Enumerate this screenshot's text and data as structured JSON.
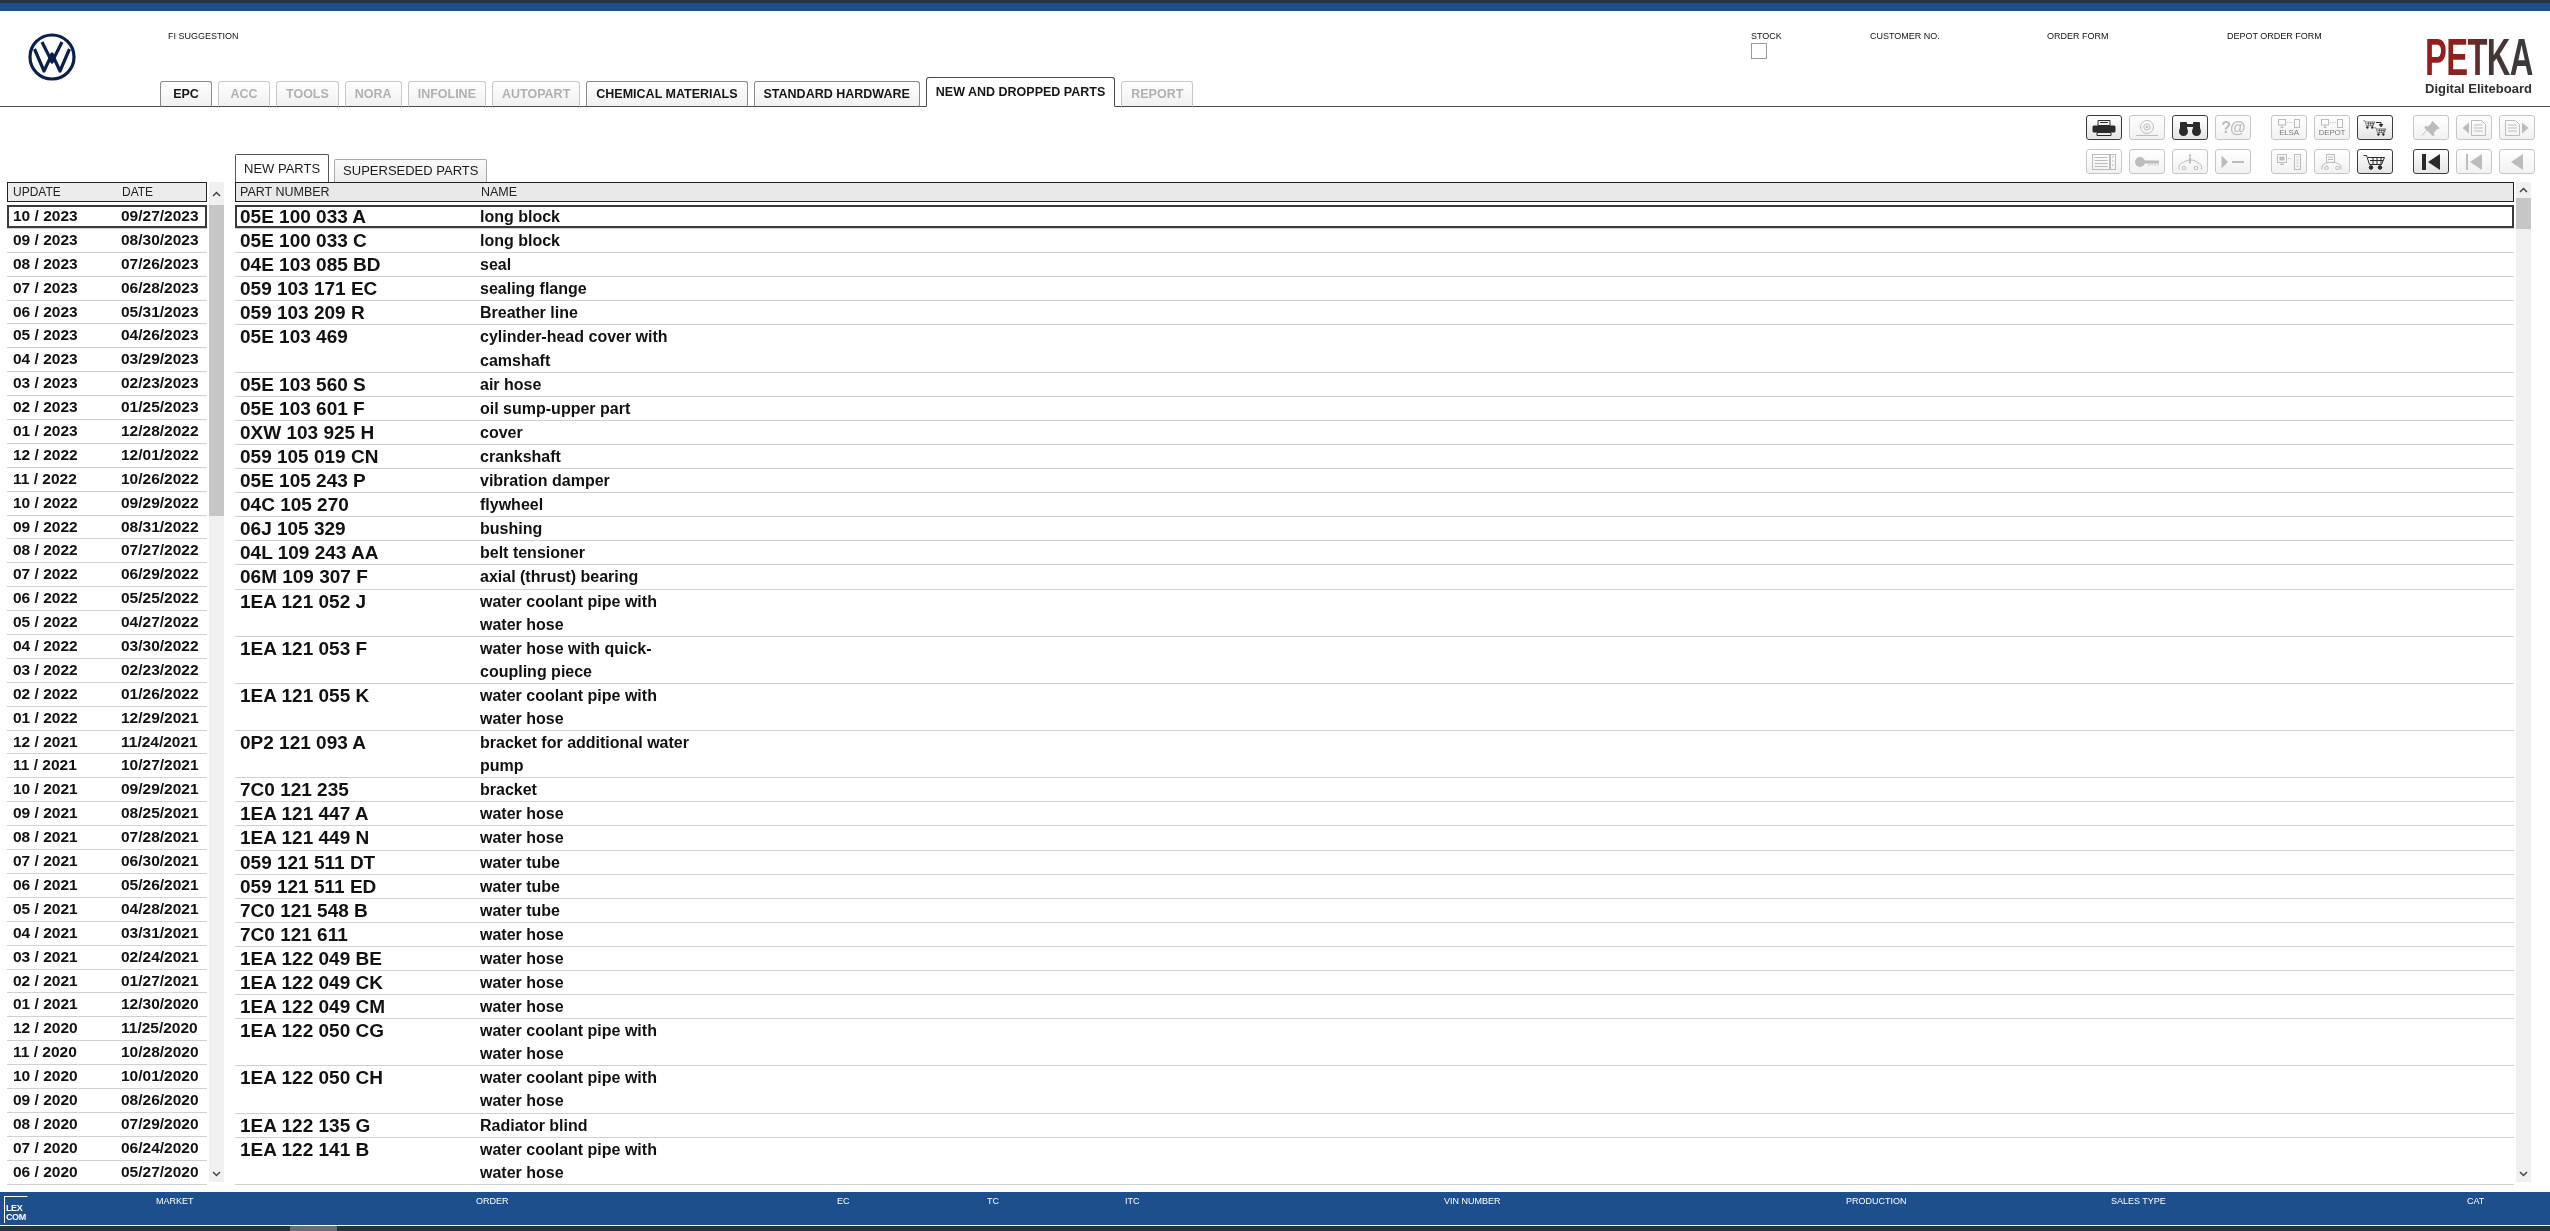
{
  "header": {
    "section_label": "FI SUGGESTION",
    "fields": [
      {
        "label": "STOCK",
        "kind": "checkbox",
        "checked": false
      },
      {
        "label": "CUSTOMER NO.",
        "kind": "label"
      },
      {
        "label": "ORDER FORM",
        "kind": "label"
      },
      {
        "label": "DEPOT ORDER FORM",
        "kind": "label"
      }
    ],
    "logo": {
      "title": "PETKA",
      "subtitle": "Digital Eliteboard"
    }
  },
  "tabs": [
    {
      "label": "EPC",
      "selected": false,
      "disabled": false
    },
    {
      "label": "ACC",
      "selected": false,
      "disabled": true
    },
    {
      "label": "TOOLS",
      "selected": false,
      "disabled": true
    },
    {
      "label": "NORA",
      "selected": false,
      "disabled": true
    },
    {
      "label": "INFOLINE",
      "selected": false,
      "disabled": true
    },
    {
      "label": "AUTOPART",
      "selected": false,
      "disabled": true
    },
    {
      "label": "CHEMICAL MATERIALS",
      "selected": false,
      "disabled": false
    },
    {
      "label": "STANDARD HARDWARE",
      "selected": false,
      "disabled": false
    },
    {
      "label": "NEW AND DROPPED PARTS",
      "selected": true,
      "disabled": false
    },
    {
      "label": "REPORT",
      "selected": false,
      "disabled": true
    }
  ],
  "toolbar": [
    [
      [
        {
          "kind": "printer",
          "disabled": false
        },
        {
          "kind": "disc",
          "disabled": true
        },
        {
          "kind": "binoculars",
          "disabled": false
        },
        {
          "kind": "glyph",
          "label": "?@",
          "disabled": true
        }
      ],
      [
        {
          "kind": "monitor",
          "label": "ELSA",
          "disabled": true
        },
        {
          "kind": "monitor",
          "label": "DEPOT",
          "disabled": true
        },
        {
          "kind": "cart_transfer",
          "disabled": false
        }
      ],
      [
        {
          "kind": "pin",
          "disabled": true
        },
        {
          "kind": "doc_prev",
          "disabled": true
        },
        {
          "kind": "doc_next",
          "disabled": true
        }
      ]
    ],
    [
      [
        {
          "kind": "list",
          "disabled": true
        },
        {
          "kind": "key",
          "disabled": true
        },
        {
          "kind": "car_info",
          "disabled": true
        },
        {
          "kind": "play_dash",
          "disabled": true
        }
      ],
      [
        {
          "kind": "pc_server",
          "disabled": true
        },
        {
          "kind": "car_doc",
          "disabled": true
        },
        {
          "kind": "cart",
          "disabled": false
        }
      ],
      [
        {
          "kind": "first",
          "disabled": false
        },
        {
          "kind": "prev_bar",
          "disabled": true
        },
        {
          "kind": "prev",
          "disabled": true
        }
      ]
    ]
  ],
  "updates": {
    "columns": [
      "UPDATE",
      "DATE"
    ],
    "rows": [
      {
        "update": "10 / 2023",
        "date": "09/27/2023",
        "selected": true
      },
      {
        "update": "09 / 2023",
        "date": "08/30/2023",
        "selected": false
      },
      {
        "update": "08 / 2023",
        "date": "07/26/2023",
        "selected": false
      },
      {
        "update": "07 / 2023",
        "date": "06/28/2023",
        "selected": false
      },
      {
        "update": "06 / 2023",
        "date": "05/31/2023",
        "selected": false
      },
      {
        "update": "05 / 2023",
        "date": "04/26/2023",
        "selected": false
      },
      {
        "update": "04 / 2023",
        "date": "03/29/2023",
        "selected": false
      },
      {
        "update": "03 / 2023",
        "date": "02/23/2023",
        "selected": false
      },
      {
        "update": "02 / 2023",
        "date": "01/25/2023",
        "selected": false
      },
      {
        "update": "01 / 2023",
        "date": "12/28/2022",
        "selected": false
      },
      {
        "update": "12 / 2022",
        "date": "12/01/2022",
        "selected": false
      },
      {
        "update": "11 / 2022",
        "date": "10/26/2022",
        "selected": false
      },
      {
        "update": "10 / 2022",
        "date": "09/29/2022",
        "selected": false
      },
      {
        "update": "09 / 2022",
        "date": "08/31/2022",
        "selected": false
      },
      {
        "update": "08 / 2022",
        "date": "07/27/2022",
        "selected": false
      },
      {
        "update": "07 / 2022",
        "date": "06/29/2022",
        "selected": false
      },
      {
        "update": "06 / 2022",
        "date": "05/25/2022",
        "selected": false
      },
      {
        "update": "05 / 2022",
        "date": "04/27/2022",
        "selected": false
      },
      {
        "update": "04 / 2022",
        "date": "03/30/2022",
        "selected": false
      },
      {
        "update": "03 / 2022",
        "date": "02/23/2022",
        "selected": false
      },
      {
        "update": "02 / 2022",
        "date": "01/26/2022",
        "selected": false
      },
      {
        "update": "01 / 2022",
        "date": "12/29/2021",
        "selected": false
      },
      {
        "update": "12 / 2021",
        "date": "11/24/2021",
        "selected": false
      },
      {
        "update": "11 / 2021",
        "date": "10/27/2021",
        "selected": false
      },
      {
        "update": "10 / 2021",
        "date": "09/29/2021",
        "selected": false
      },
      {
        "update": "09 / 2021",
        "date": "08/25/2021",
        "selected": false
      },
      {
        "update": "08 / 2021",
        "date": "07/28/2021",
        "selected": false
      },
      {
        "update": "07 / 2021",
        "date": "06/30/2021",
        "selected": false
      },
      {
        "update": "06 / 2021",
        "date": "05/26/2021",
        "selected": false
      },
      {
        "update": "05 / 2021",
        "date": "04/28/2021",
        "selected": false
      },
      {
        "update": "04 / 2021",
        "date": "03/31/2021",
        "selected": false
      },
      {
        "update": "03 / 2021",
        "date": "02/24/2021",
        "selected": false
      },
      {
        "update": "02 / 2021",
        "date": "01/27/2021",
        "selected": false
      },
      {
        "update": "01 / 2021",
        "date": "12/30/2020",
        "selected": false
      },
      {
        "update": "12 / 2020",
        "date": "11/25/2020",
        "selected": false
      },
      {
        "update": "11 / 2020",
        "date": "10/28/2020",
        "selected": false
      },
      {
        "update": "10 / 2020",
        "date": "10/01/2020",
        "selected": false
      },
      {
        "update": "09 / 2020",
        "date": "08/26/2020",
        "selected": false
      },
      {
        "update": "08 / 2020",
        "date": "07/29/2020",
        "selected": false
      },
      {
        "update": "07 / 2020",
        "date": "06/24/2020",
        "selected": false
      },
      {
        "update": "06 / 2020",
        "date": "05/27/2020",
        "selected": false
      }
    ]
  },
  "parts_tabs": [
    {
      "label": "NEW PARTS",
      "selected": true
    },
    {
      "label": "SUPERSEDED PARTS",
      "selected": false
    }
  ],
  "parts": {
    "columns": [
      "PART NUMBER",
      "NAME"
    ],
    "rows": [
      {
        "part_number": "05E 100 033 A",
        "name": "long block",
        "selected": true
      },
      {
        "part_number": "05E 100 033 C",
        "name": "long block",
        "selected": false
      },
      {
        "part_number": "04E 103 085 BD",
        "name": "seal",
        "selected": false
      },
      {
        "part_number": "059 103 171 EC",
        "name": "sealing flange",
        "selected": false
      },
      {
        "part_number": "059 103 209 R",
        "name": "Breather line",
        "selected": false
      },
      {
        "part_number": "05E 103 469",
        "name": "cylinder-head cover with camshaft",
        "selected": false
      },
      {
        "part_number": "05E 103 560 S",
        "name": "air hose",
        "selected": false
      },
      {
        "part_number": "05E 103 601 F",
        "name": "oil sump-upper part",
        "selected": false
      },
      {
        "part_number": "0XW 103 925 H",
        "name": "cover",
        "selected": false
      },
      {
        "part_number": "059 105 019 CN",
        "name": "crankshaft",
        "selected": false
      },
      {
        "part_number": "05E 105 243 P",
        "name": "vibration damper",
        "selected": false
      },
      {
        "part_number": "04C 105 270",
        "name": "flywheel",
        "selected": false
      },
      {
        "part_number": "06J 105 329",
        "name": "bushing",
        "selected": false
      },
      {
        "part_number": "04L 109 243 AA",
        "name": "belt tensioner",
        "selected": false
      },
      {
        "part_number": "06M 109 307 F",
        "name": "axial (thrust) bearing",
        "selected": false
      },
      {
        "part_number": "1EA 121 052 J",
        "name": "water coolant pipe with water hose",
        "selected": false
      },
      {
        "part_number": "1EA 121 053 F",
        "name": "water hose with quick-coupling piece",
        "selected": false
      },
      {
        "part_number": "1EA 121 055 K",
        "name": "water coolant pipe with water hose",
        "selected": false
      },
      {
        "part_number": "0P2 121 093 A",
        "name": "bracket for additional water pump",
        "selected": false
      },
      {
        "part_number": "7C0 121 235",
        "name": "bracket",
        "selected": false
      },
      {
        "part_number": "1EA 121 447 A",
        "name": "water hose",
        "selected": false
      },
      {
        "part_number": "1EA 121 449 N",
        "name": "water hose",
        "selected": false
      },
      {
        "part_number": "059 121 511 DT",
        "name": "water tube",
        "selected": false
      },
      {
        "part_number": "059 121 511 ED",
        "name": "water tube",
        "selected": false
      },
      {
        "part_number": "7C0 121 548 B",
        "name": "water tube",
        "selected": false
      },
      {
        "part_number": "7C0 121 611",
        "name": "water hose",
        "selected": false
      },
      {
        "part_number": "1EA 122 049 BE",
        "name": "water hose",
        "selected": false
      },
      {
        "part_number": "1EA 122 049 CK",
        "name": "water hose",
        "selected": false
      },
      {
        "part_number": "1EA 122 049 CM",
        "name": "water hose",
        "selected": false
      },
      {
        "part_number": "1EA 122 050 CG",
        "name": "water coolant pipe with water hose",
        "selected": false
      },
      {
        "part_number": "1EA 122 050 CH",
        "name": "water coolant pipe with water hose",
        "selected": false
      },
      {
        "part_number": "1EA 122 135 G",
        "name": "Radiator blind",
        "selected": false
      },
      {
        "part_number": "1EA 122 141 B",
        "name": "water coolant pipe with water hose",
        "selected": false
      }
    ]
  },
  "status_bar": {
    "logo": [
      "LEX",
      "COM"
    ],
    "fields": [
      "MARKET",
      "ORDER",
      "EC",
      "TC",
      "ITC",
      "VIN NUMBER",
      "PRODUCTION",
      "SALES TYPE",
      "CAT"
    ]
  }
}
